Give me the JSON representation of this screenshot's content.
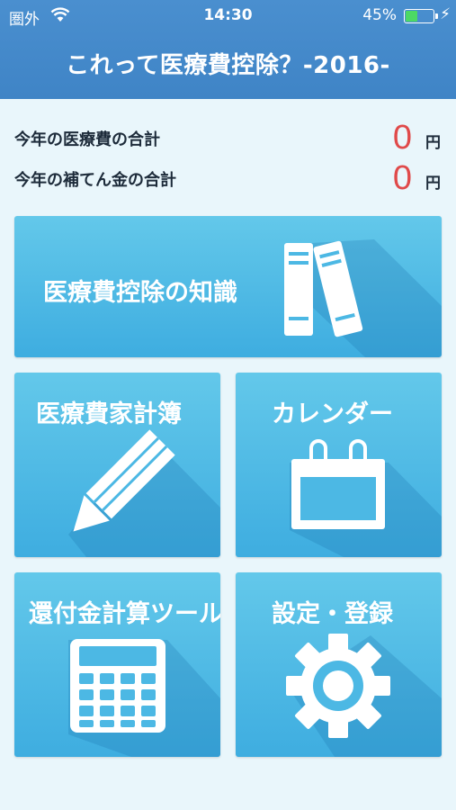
{
  "status": {
    "carrier": "圏外",
    "time": "14:30",
    "battery_percent_label": "45%",
    "battery_level": 0.45
  },
  "header": {
    "title": "これって医療費控除？-2016-"
  },
  "totals": [
    {
      "label": "今年の医療費の合計",
      "amount": "0",
      "unit": "円"
    },
    {
      "label": "今年の補てん金の合計",
      "amount": "0",
      "unit": "円"
    }
  ],
  "tiles": {
    "knowledge": {
      "label": "医療費控除の知識",
      "icon": "books-icon"
    },
    "household": {
      "label": "医療費家計簿",
      "icon": "pencil-icon"
    },
    "calendar": {
      "label": "カレンダー",
      "icon": "calendar-icon"
    },
    "refund": {
      "label": "還付金計算ツール",
      "icon": "calculator-icon"
    },
    "settings": {
      "label": "設定・登録",
      "icon": "gear-icon"
    }
  },
  "colors": {
    "header": "#4389c9",
    "tile": "#4cb8e4",
    "amount": "#e04a4a",
    "background": "#e9f6fb"
  }
}
